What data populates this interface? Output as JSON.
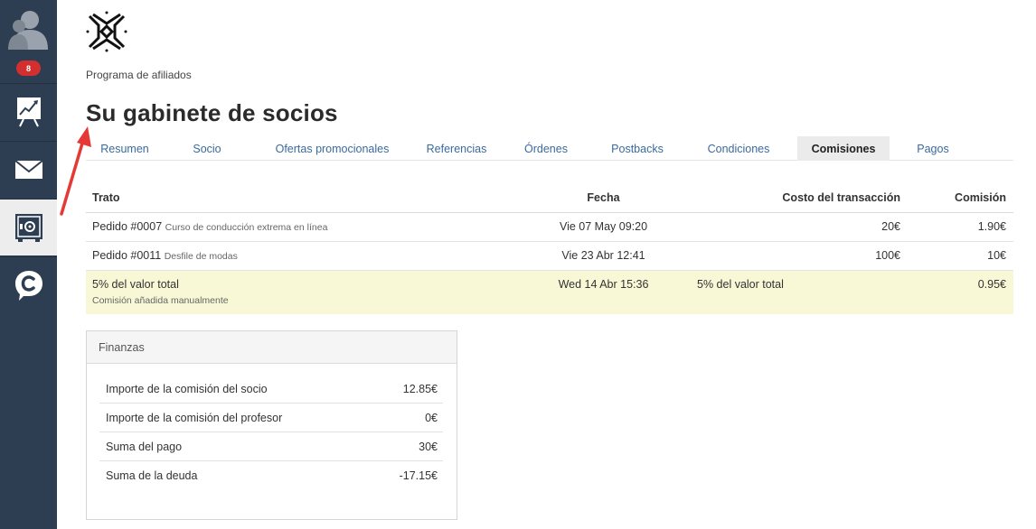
{
  "sidebar": {
    "badge": "8",
    "items": [
      {
        "icon": "presentation-chart-icon"
      },
      {
        "icon": "envelope-icon"
      },
      {
        "icon": "safe-icon",
        "active": true
      },
      {
        "icon": "chat-c-icon"
      }
    ]
  },
  "header": {
    "program": "Programa de afiliados",
    "title": "Su gabinete de socios"
  },
  "tabs": [
    {
      "label": "Resumen"
    },
    {
      "label": "Socio"
    },
    {
      "label": "Ofertas promocionales"
    },
    {
      "label": "Referencias"
    },
    {
      "label": "Órdenes"
    },
    {
      "label": "Postbacks"
    },
    {
      "label": "Condiciones"
    },
    {
      "label": "Comisiones",
      "active": true
    },
    {
      "label": "Pagos"
    }
  ],
  "table": {
    "headers": {
      "deal": "Trato",
      "date": "Fecha",
      "cost": "Costo del transacción",
      "commission": "Comisión"
    },
    "rows": [
      {
        "deal": "Pedido #0007",
        "deal_sub": "Curso de conducción extrema en línea",
        "date": "Vie 07 May 09:20",
        "cost": "20€",
        "commission": "1.90€"
      },
      {
        "deal": "Pedido #0011",
        "deal_sub": "Desfile de modas",
        "date": "Vie 23 Abr 12:41",
        "cost": "100€",
        "commission": "10€"
      },
      {
        "deal": "5% del valor total",
        "deal_note": "Comisión añadida manualmente",
        "date": "Wed 14 Abr 15:36",
        "cost": "5% del valor total",
        "commission": "0.95€"
      }
    ]
  },
  "finance": {
    "title": "Finanzas",
    "rows": [
      {
        "label": "Importe de la comisión del socio",
        "value": "12.85€"
      },
      {
        "label": "Importe de la comisión del profesor",
        "value": "0€"
      },
      {
        "label": "Suma del pago",
        "value": "30€"
      },
      {
        "label": "Suma de la deuda",
        "value": "-17.15€"
      }
    ]
  },
  "colors": {
    "sidebar": "#2e3e52",
    "badge": "#d32f2f",
    "link": "#3a6a9e",
    "highlight_row": "#f8f8d6",
    "annotation_arrow": "#e53935"
  }
}
